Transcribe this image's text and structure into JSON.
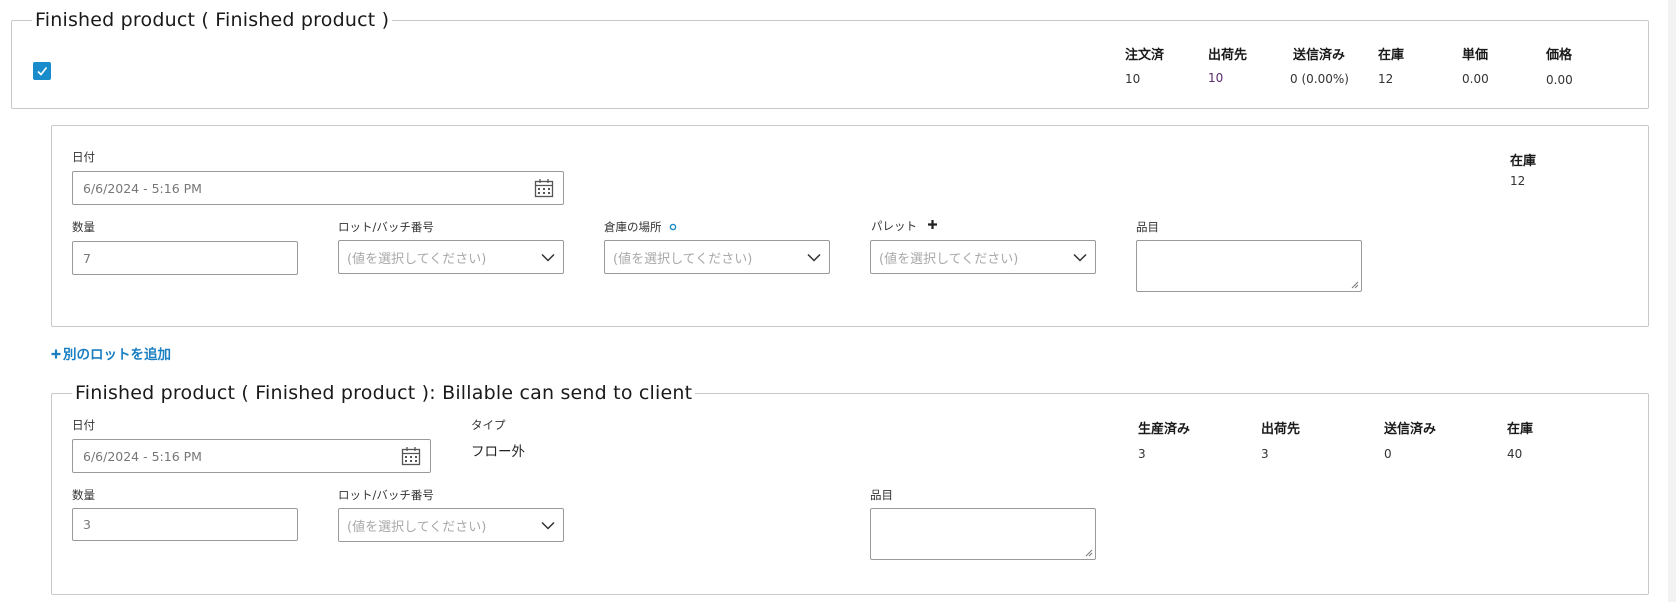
{
  "section1": {
    "legend": "Finished product ( Finished product )",
    "checkbox_checked": true,
    "columns": [
      {
        "header": "注文済",
        "value": "10"
      },
      {
        "header": "出荷先",
        "value": "10"
      },
      {
        "header": "送信済み",
        "value": "0 (0.00%)"
      },
      {
        "header": "在庫",
        "value": "12"
      },
      {
        "header": "単価",
        "value": "0.00"
      },
      {
        "header": "価格",
        "value": "0.00"
      }
    ]
  },
  "lot": {
    "date_label": "日付",
    "date_value": "6/6/2024 - 5:16 PM",
    "stock_label": "在庫",
    "stock_value": "12",
    "qty_label": "数量",
    "qty_value": "7",
    "lot_label": "ロット/バッチ番号",
    "lot_placeholder": "(値を選択してください)",
    "location_label": "倉庫の場所",
    "location_placeholder": "(値を選択してください)",
    "pallet_label": "パレット",
    "pallet_placeholder": "(値を選択してください)",
    "item_label": "品目"
  },
  "add_lot_label": "別のロットを追加",
  "section2": {
    "legend": "Finished product ( Finished product ): Billable can send to client",
    "date_label": "日付",
    "date_value": "6/6/2024 - 5:16 PM",
    "type_label": "タイプ",
    "type_value": "フロー外",
    "qty_label": "数量",
    "qty_value": "3",
    "lot_label": "ロット/バッチ番号",
    "lot_placeholder": "(値を選択してください)",
    "item_label": "品目",
    "columns": [
      {
        "header": "生産済み",
        "value": "3"
      },
      {
        "header": "出荷先",
        "value": "3"
      },
      {
        "header": "送信済み",
        "value": "0"
      },
      {
        "header": "在庫",
        "value": "40"
      }
    ]
  },
  "colors": {
    "accent": "#1a8ccc",
    "link": "#1a7fc1",
    "border": "#c9c9c9"
  },
  "icons": [
    "check-icon",
    "calendar-icon",
    "chevron-down-icon",
    "plus-icon",
    "info-dot-icon",
    "resize-grip-icon"
  ]
}
